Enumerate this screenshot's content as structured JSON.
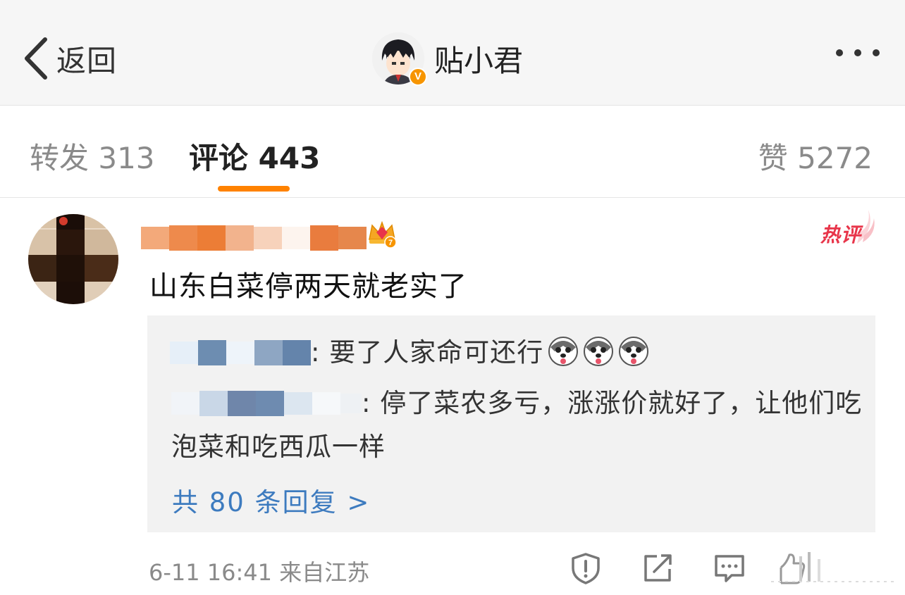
{
  "header": {
    "back_label": "返回",
    "profile_name": "贴小君",
    "verified_badge": "V"
  },
  "tabs": [
    {
      "label": "转发 313",
      "active": false
    },
    {
      "label": "评论 443",
      "active": true
    },
    {
      "label": "赞 5272",
      "active": false
    }
  ],
  "comment": {
    "hot_label": "热评",
    "level_badge": "7",
    "text": "山东白菜停两天就老实了",
    "replies": [
      {
        "text": ": 要了人家命可还行",
        "emojis": 3
      },
      {
        "text": ": 停了菜农多亏，涨涨价就好了，让他们吃泡菜和吃西瓜一样"
      }
    ],
    "more_replies": "共 80 条回复 >",
    "meta": "6-11 16:41  来自江苏"
  },
  "actions": [
    "report-icon",
    "share-icon",
    "comment-icon",
    "like-icon"
  ],
  "colors": {
    "accent": "#ff8200",
    "link": "#3d7bbf",
    "hot": "#e8354a",
    "badge": "#f79500"
  }
}
